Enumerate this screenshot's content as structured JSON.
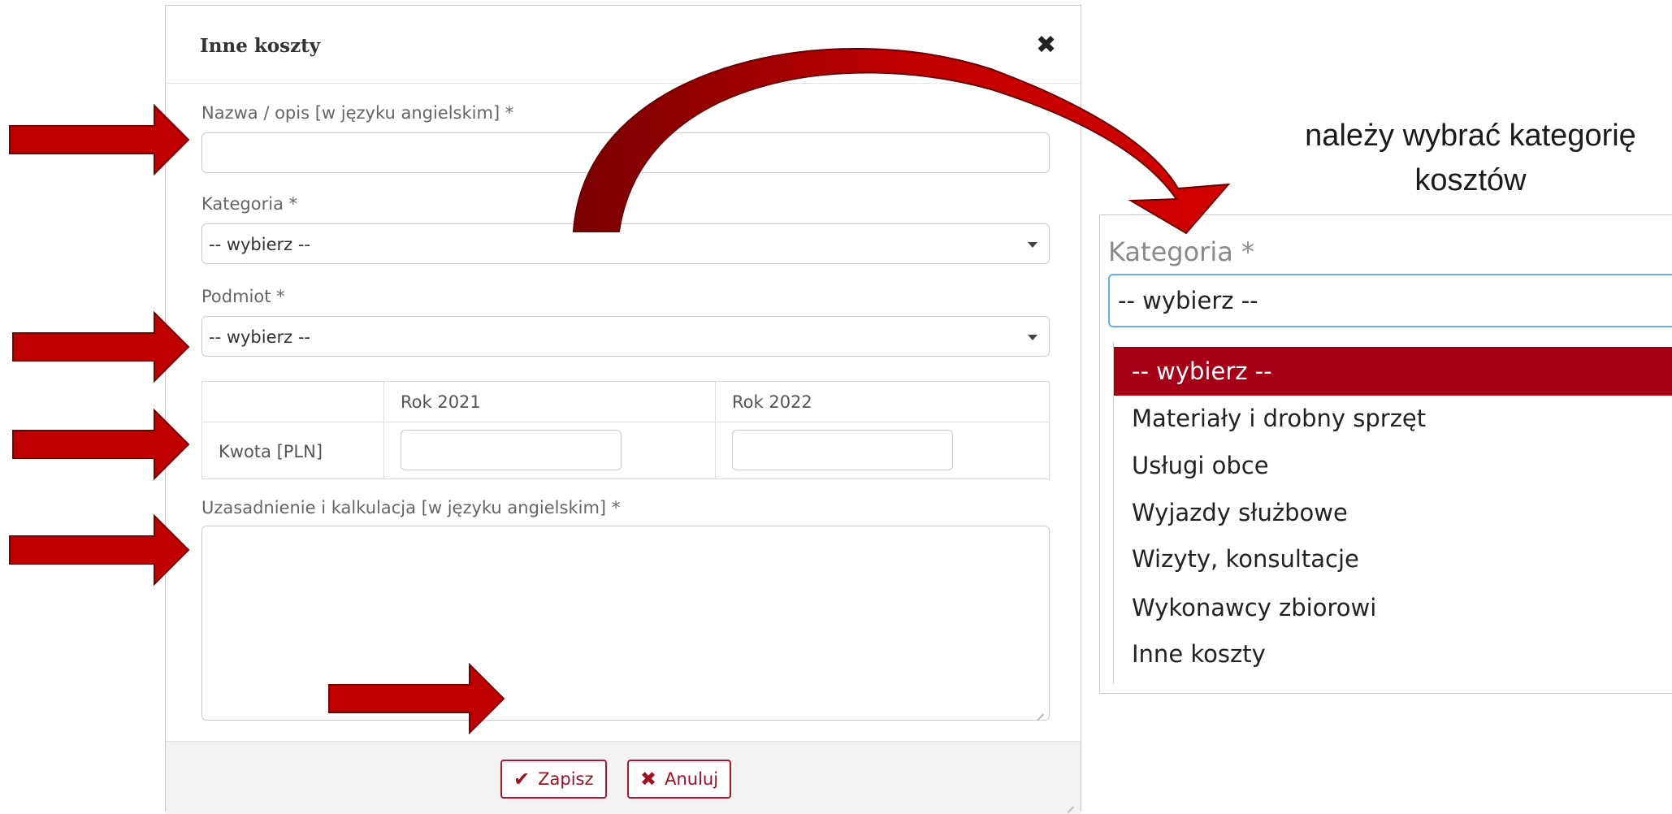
{
  "modal": {
    "title": "Inne koszty",
    "close_glyph": "✖",
    "name_label": "Nazwa / opis [w języku angielskim] *",
    "name_value": "",
    "category_label": "Kategoria *",
    "category_value": "-- wybierz --",
    "entity_label": "Podmiot *",
    "entity_value": "-- wybierz --",
    "amounts": {
      "col_2021": "Rok 2021",
      "col_2022": "Rok 2022",
      "row_label": "Kwota [PLN]",
      "value_2021": "",
      "value_2022": ""
    },
    "justification_label": "Uzasadnienie i kalkulacja [w języku angielskim] *",
    "justification_value": "",
    "save_icon": "✔",
    "save_label": "Zapisz",
    "cancel_icon": "✖",
    "cancel_label": "Anuluj"
  },
  "annotation": {
    "line1": "należy wybrać kategorię",
    "line2": "kosztów"
  },
  "zoom": {
    "label": "Kategoria *",
    "selected": "-- wybierz --",
    "options": [
      "-- wybierz --",
      "Materiały i drobny sprzęt",
      "Usługi obce",
      "Wyjazdy służbowe",
      "Wizyty, konsultacje",
      "Wykonawcy zbiorowi",
      "Inne koszty"
    ]
  },
  "colors": {
    "arrow_red": "#c00000",
    "selected_option_bg": "#a50015",
    "button_border": "#b5132b",
    "focus_border": "#66afe9"
  }
}
